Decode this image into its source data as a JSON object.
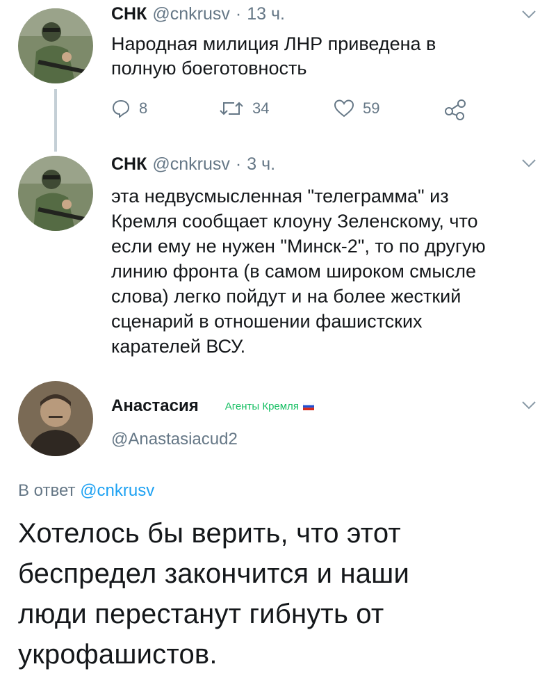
{
  "thread": [
    {
      "name": "СНК",
      "handle": "@cnkrusv",
      "separator": "·",
      "time": "13 ч.",
      "text_lines": [
        "Народная милиция ЛНР приведена в",
        "полную боеготовность"
      ],
      "replies": "8",
      "retweets": "34",
      "likes": "59"
    },
    {
      "name": "СНК",
      "handle": "@cnkrusv",
      "separator": "·",
      "time": "3 ч.",
      "text_lines": [
        "эта недвусмысленная \"телеграмма\" из",
        "Кремля сообщает  клоуну Зеленскому, что",
        "если ему не нужен \"Минск-2\", то по другую",
        "линию фронта (в самом широком смысле",
        "слова) легко пойдут и на более жесткий",
        "сценарий в отношении фашистских",
        "карателей ВСУ."
      ]
    }
  ],
  "main_tweet": {
    "name": "Анастасия",
    "badge": "Агенты Кремля",
    "handle": "@Anastasiacud2",
    "reply_prefix": "В ответ",
    "reply_to": "@cnkrusv",
    "text_lines": [
      "Хотелось бы верить, что этот",
      "беспредел закончится и наши",
      "люди перестанут гибнуть от",
      "укрофашистов."
    ]
  },
  "colors": {
    "text": "#14171a",
    "secondary": "#657786",
    "link": "#1da1f2",
    "badge": "#17bf63"
  },
  "icons": [
    "chevron-down-icon",
    "reply-icon",
    "retweet-icon",
    "like-icon",
    "share-icon",
    "russian-flag-icon"
  ]
}
